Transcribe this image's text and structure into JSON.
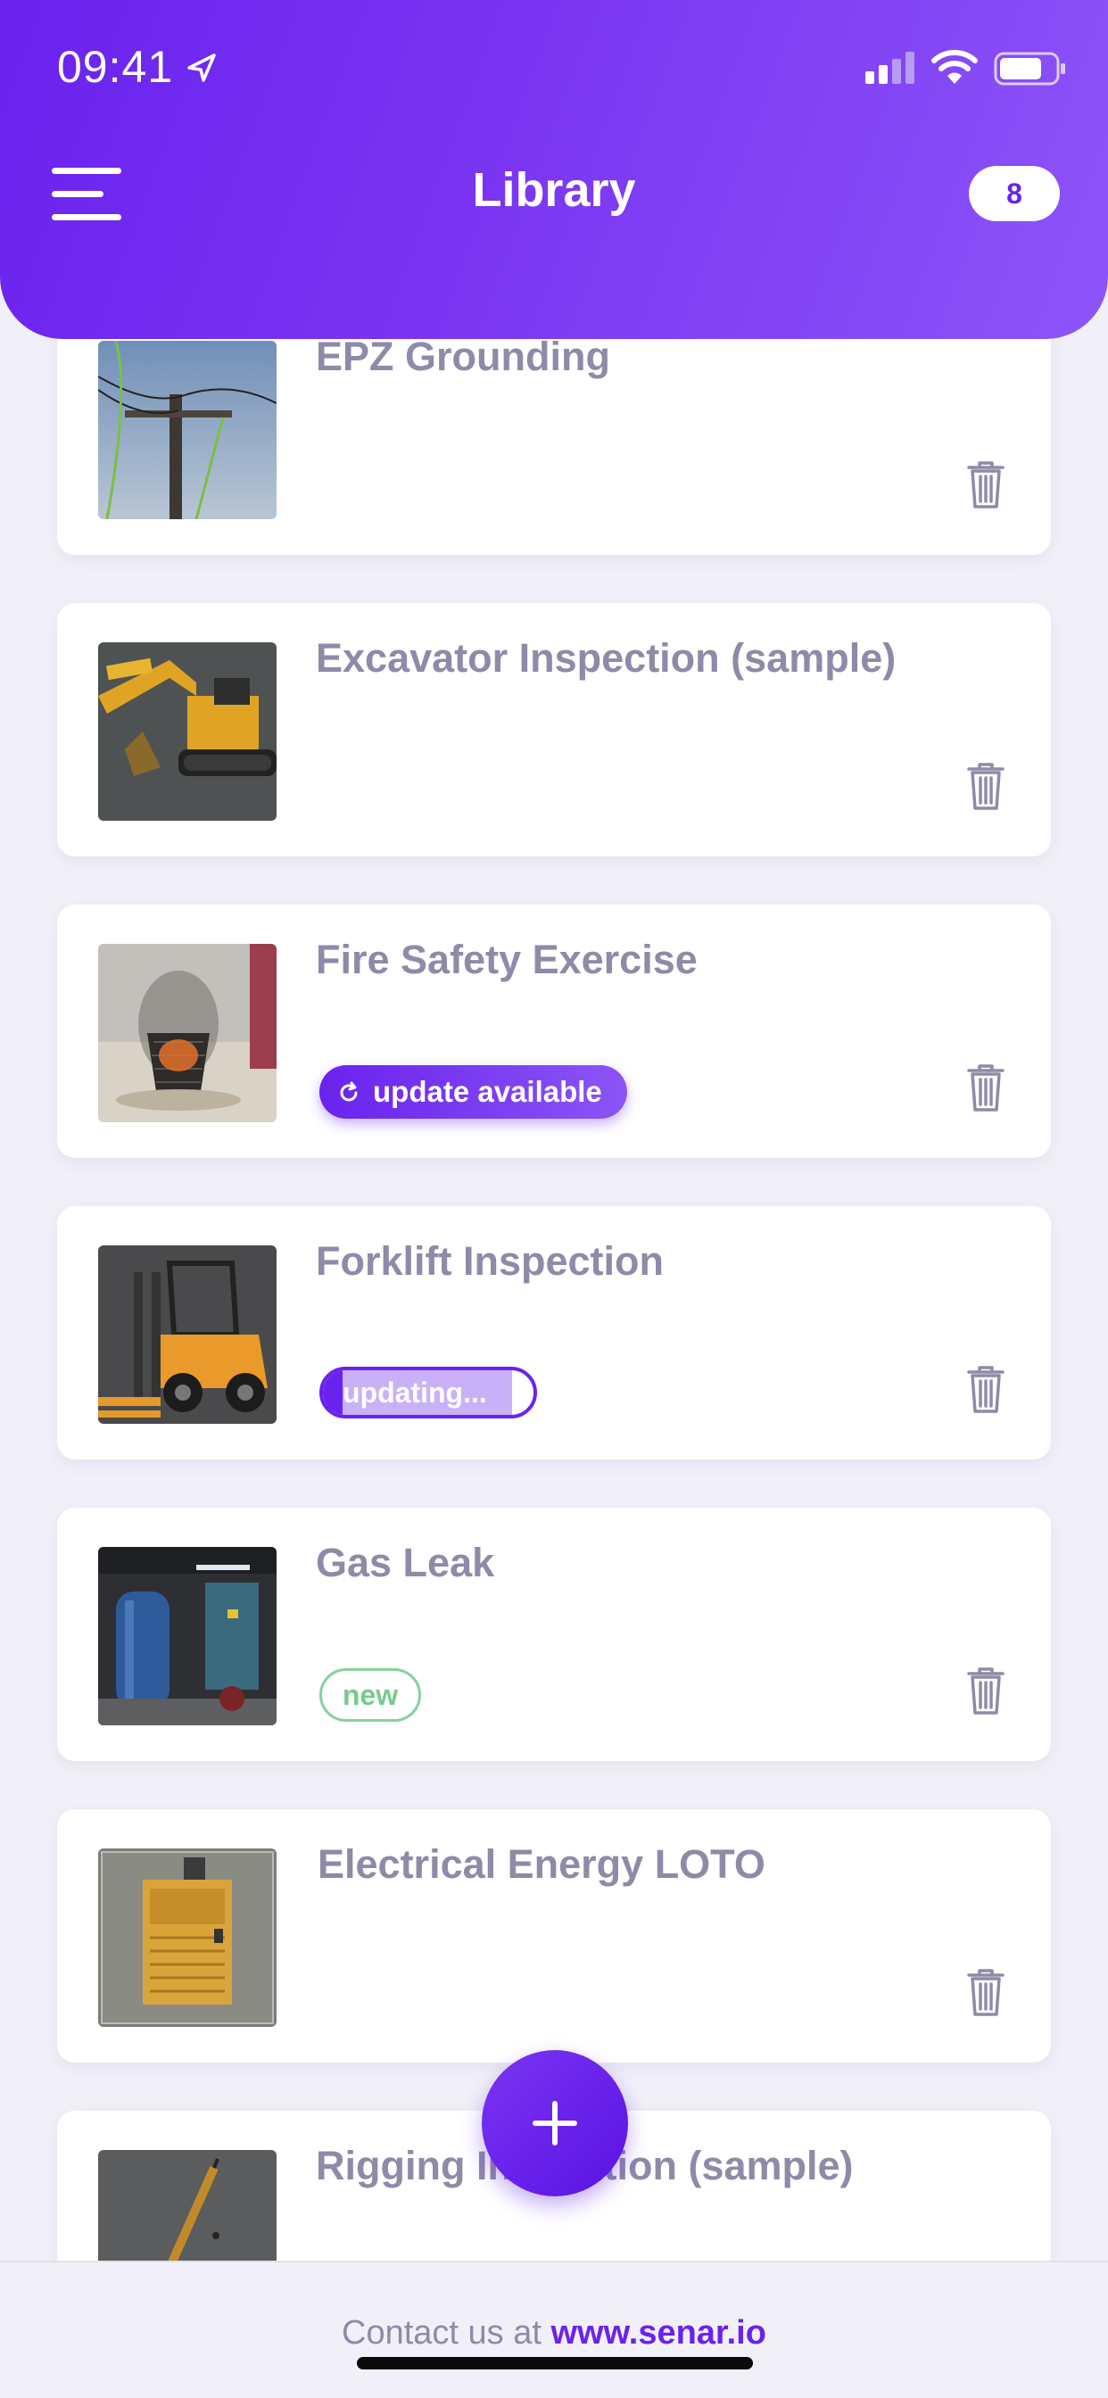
{
  "status_bar": {
    "time": "09:41"
  },
  "header": {
    "title": "Library",
    "count": "8"
  },
  "items": [
    {
      "title": "EPZ Grounding",
      "thumbnail": "power-pole-thumbnail"
    },
    {
      "title": "Excavator Inspection (sample)",
      "thumbnail": "excavator-thumbnail"
    },
    {
      "title": "Fire Safety Exercise",
      "thumbnail": "fire-basket-thumbnail",
      "badge": "update available"
    },
    {
      "title": "Forklift Inspection",
      "thumbnail": "forklift-thumbnail",
      "badge": "updating...",
      "progress": 0.15
    },
    {
      "title": "Gas Leak",
      "thumbnail": "gas-tank-room-thumbnail",
      "badge": "new"
    },
    {
      "title": "Electrical Energy LOTO",
      "thumbnail": "baler-machine-thumbnail"
    },
    {
      "title": "Rigging Inspection (sample)",
      "thumbnail": "crane-thumbnail"
    }
  ],
  "fab": {
    "icon": "plus-icon"
  },
  "footer": {
    "prefix": "Contact us at ",
    "link": "www.senar.io"
  },
  "colors": {
    "accent": "#6a22ee",
    "muted_text": "#8f8aa8",
    "new_green": "#78c98d",
    "background": "#f1f0f8"
  }
}
